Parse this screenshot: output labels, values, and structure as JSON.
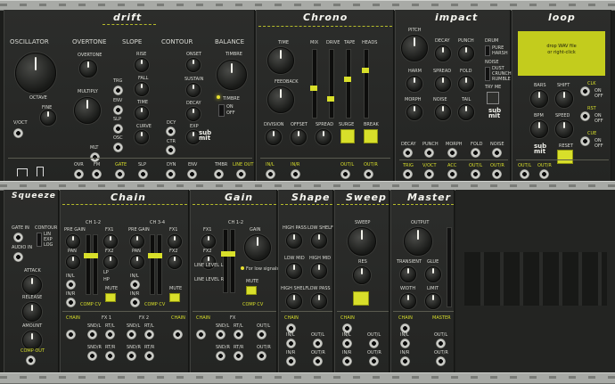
{
  "modules": {
    "drift": {
      "title": "drift",
      "oscillator": "OSCILLATOR",
      "overtone": "OVERTONE",
      "slope": "SLOPE",
      "contour": "CONTOUR",
      "balance": "BALANCE",
      "octave": "OCTAVE",
      "fine": "FINE",
      "overtone_knob": "OVERTONE",
      "multiply": "MULTIPLY",
      "rise": "RISE",
      "fall": "FALL",
      "time": "TIME",
      "curve": "CURVE",
      "onset": "ONSET",
      "sustain": "SUSTAIN",
      "decay": "DECAY",
      "exp": "EXP",
      "timbre": "TIMBRE",
      "timbre2": "TIMBRE",
      "on": "on",
      "off": "off",
      "voct": "V/OCT",
      "trg": "TRG",
      "env": "ENV",
      "slp": "SLP",
      "osc": "OSC",
      "dcy": "DCY",
      "ctr": "CTR",
      "mlt": "MLT",
      "ovr": "OVR",
      "fm": "FM",
      "gate": "GATE",
      "slp2": "SLP",
      "dyn": "DYN",
      "env2": "ENV",
      "tmbr": "TMBR",
      "line_out": "LINE OUT"
    },
    "chrono": {
      "title": "Chrono",
      "time": "TIME",
      "feedback": "FEEDBACK",
      "mix": "MIX",
      "drive": "DRIVE",
      "tape": "TAPE",
      "heads": "HEADS",
      "division": "DIVISION",
      "offset": "OFFSET",
      "spread": "SPREAD",
      "surge": "SURGE",
      "break": "BREAK",
      "in_l": "IN/L",
      "in_r": "IN/R",
      "out_l": "OUT/L",
      "out_r": "OUT/R"
    },
    "impact": {
      "title": "impact",
      "pitch": "PITCH",
      "decay": "DECAY",
      "punch": "PUNCH",
      "drum": "DRUM",
      "pure": "pure",
      "harsh": "harsh",
      "noise": "NOISE",
      "dust": "dust",
      "crunch": "crunch",
      "rumble": "rumble",
      "harm": "HARM",
      "spread": "SPREAD",
      "fold": "FOLD",
      "morph": "MORPH",
      "noise2": "NOISE",
      "tail": "TAIL",
      "try_me": "TRY ME",
      "decay2": "DECAY",
      "punch2": "PUNCH",
      "morph2": "MORPH",
      "fold2": "FOLD",
      "noise3": "NOISE",
      "trig": "TRIG",
      "voct": "V/OCT",
      "acc": "ACC",
      "out_l": "OUT/L",
      "out_r": "OUT/R"
    },
    "loop": {
      "title": "loop",
      "screen_line1": "drop WAV file",
      "screen_line2": "or right-click",
      "bars": "BARS",
      "shift": "SHIFT",
      "bpm": "BPM",
      "speed": "SPEED",
      "reset": "RESET",
      "clk": "CLK",
      "on": "on",
      "off": "off",
      "rst": "RST",
      "cue": "CUE",
      "out_l": "OUT/L",
      "out_r": "OUT/R"
    },
    "squeeze": {
      "title": "Squeeze",
      "gate_in": "GATE IN",
      "contour": "CONTOUR",
      "lin": "lin",
      "exp": "exp",
      "log": "log",
      "audio_in": "AUDIO IN",
      "attack": "ATTACK",
      "release": "RELEASE",
      "amount": "AMOUNT",
      "comp_out": "COMP OUT"
    },
    "chain": {
      "title": "Chain",
      "ch12": "CH 1-2",
      "ch34": "CH 3-4",
      "pre_gain": "PRE GAIN",
      "pre_gain2": "PRE GAIN",
      "pan": "PAN",
      "pan2": "PAN",
      "fx1": "FX1",
      "fx2": "FX2",
      "fx1b": "FX1",
      "fx2b": "FX2",
      "lp": "LP",
      "hp": "HP",
      "mute": "MUTE",
      "mute2": "MUTE",
      "in_l": "IN/L",
      "in_r": "IN/R",
      "in_l2": "IN/L",
      "in_r2": "IN/R",
      "comp_cv": "COMP CV",
      "comp_cv2": "COMP CV",
      "chain": "CHAIN",
      "fx1_bus": "FX 1",
      "fx2_bus": "FX 2",
      "snd_l": "SND/L",
      "rtn_l": "RT/L",
      "snd_r": "SND/R",
      "rtn_r": "RT/R",
      "snd_l2": "SND/L",
      "rtn_l2": "RT/L",
      "snd_r2": "SND/R",
      "rtn_r2": "RT/R",
      "chain2": "CHAIN"
    },
    "gain": {
      "title": "Gain",
      "ch12": "CH 1-2",
      "fx1": "FX1",
      "fx2": "FX2",
      "gain": "GAIN",
      "line_level_l": "LINE LEVEL L",
      "line_level_r": "LINE LEVEL R",
      "low_signals": "For low signals",
      "mute": "MUTE",
      "comp_cv": "COMP CV",
      "chain": "CHAIN",
      "fx": "FX",
      "out_l": "OUT/L",
      "out_r": "OUT/R",
      "snd_l": "SND/L",
      "rtn_l": "RT/L",
      "snd_r": "SND/R",
      "rtn_r": "RT/R"
    },
    "shape": {
      "title": "Shape",
      "high_pass": "HIGH PASS",
      "low_shelf": "LOW SHELF",
      "low_mid": "LOW MID",
      "high_mid": "HIGH MID",
      "high_shelf": "HIGH SHELF",
      "low_pass": "LOW PASS",
      "chain": "CHAIN",
      "in_l": "IN/L",
      "in_r": "IN/R",
      "out_l": "OUT/L",
      "out_r": "OUT/R"
    },
    "sweep": {
      "title": "Sweep",
      "sweep": "SWEEP",
      "res": "RES",
      "chain": "CHAIN",
      "in_l": "IN/L",
      "in_r": "IN/R",
      "out_l": "OUT/L",
      "out_r": "OUT/R"
    },
    "master": {
      "title": "Master",
      "output": "OUTPUT",
      "transient": "TRANSIENT",
      "glue": "GLUE",
      "width": "WIDTH",
      "limit": "LIMIT",
      "chain": "CHAIN",
      "master": "MASTER",
      "in_l": "IN/L",
      "in_r": "IN/R",
      "out_l": "OUT/L",
      "out_r": "OUT/R"
    }
  },
  "colors": {
    "accent": "#d8df2a",
    "panel": "#2a2b29",
    "rail": "#a8aaa6"
  },
  "logo_text": "sub mit"
}
